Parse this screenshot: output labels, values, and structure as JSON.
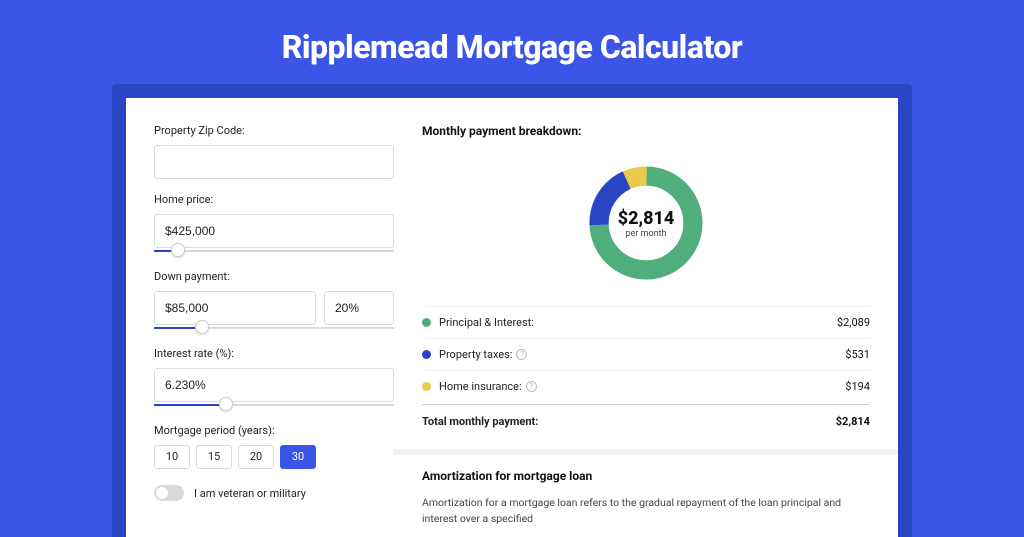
{
  "header": {
    "title": "Ripplemead Mortgage Calculator"
  },
  "form": {
    "zip_label": "Property Zip Code:",
    "zip_value": "",
    "home_price_label": "Home price:",
    "home_price_value": "$425,000",
    "down_payment_label": "Down payment:",
    "down_payment_value": "$85,000",
    "down_payment_pct": "20%",
    "interest_label": "Interest rate (%):",
    "interest_value": "6.230%",
    "period_label": "Mortgage period (years):",
    "period_options": [
      "10",
      "15",
      "20",
      "30"
    ],
    "period_selected": "30",
    "veteran_label": "I am veteran or military"
  },
  "breakdown": {
    "title": "Monthly payment breakdown:",
    "center_amount": "$2,814",
    "center_sub": "per month",
    "items": [
      {
        "color": "green",
        "label": "Principal & Interest:",
        "help": false,
        "value": "$2,089"
      },
      {
        "color": "blue",
        "label": "Property taxes:",
        "help": true,
        "value": "$531"
      },
      {
        "color": "yellow",
        "label": "Home insurance:",
        "help": true,
        "value": "$194"
      }
    ],
    "total_label": "Total monthly payment:",
    "total_value": "$2,814"
  },
  "amortization": {
    "title": "Amortization for mortgage loan",
    "body": "Amortization for a mortgage loan refers to the gradual repayment of the loan principal and interest over a specified"
  },
  "chart_data": {
    "type": "pie",
    "title": "Monthly payment breakdown",
    "series": [
      {
        "name": "Principal & Interest",
        "value": 2089,
        "color": "#4fae7b"
      },
      {
        "name": "Property taxes",
        "value": 531,
        "color": "#2a45c4"
      },
      {
        "name": "Home insurance",
        "value": 194,
        "color": "#e9c94e"
      }
    ],
    "total": 2814,
    "center_label": "$2,814 per month"
  },
  "colors": {
    "accent": "#3b55e6",
    "accent_dark": "#2a45c4",
    "green": "#4fae7b",
    "yellow": "#e9c94e"
  }
}
